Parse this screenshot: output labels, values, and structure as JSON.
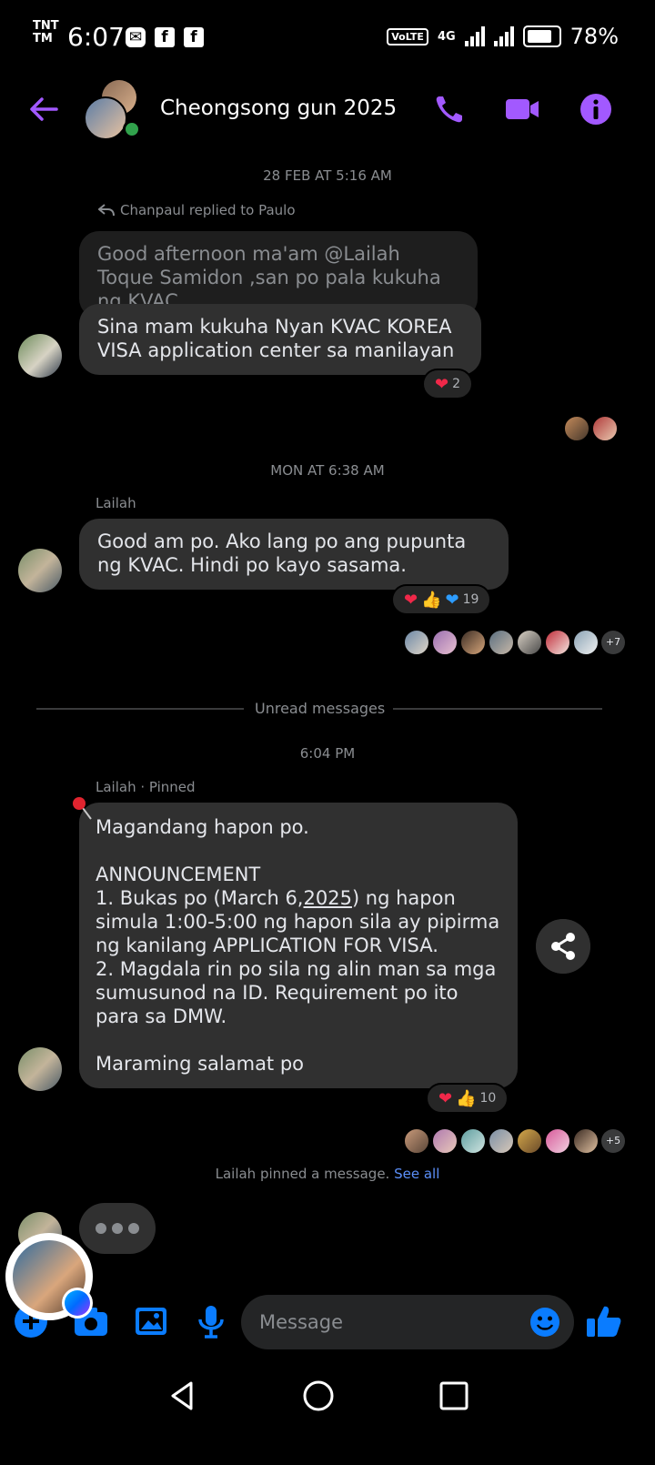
{
  "status_bar": {
    "carrier_line1": "TNT",
    "carrier_line2": "TM",
    "time": "6:07",
    "network": "4G",
    "volte": "VoLTE",
    "battery": "78%",
    "notification_icons": [
      "messenger-notification-icon",
      "facebook-icon",
      "facebook-icon"
    ]
  },
  "header": {
    "title": "Cheongsong gun 2025",
    "accent": "#a259ff",
    "online": true
  },
  "messages": {
    "ts1": "28 FEB AT 5:16 AM",
    "reply_note": "Chanpaul replied to Paulo",
    "quoted_text": "Good afternoon ma'am @Lailah Toque Samidon ,san po pala kukuha ng KVAC",
    "reply_text": "Sina mam  kukuha Nyan  KVAC  KOREA VISA application center sa manilayan",
    "reply_reaction_count": "2",
    "ts2": "MON AT 6:38 AM",
    "sender2": "Lailah",
    "msg2_text": "Good am po. Ako lang po ang pupunta ng KVAC. Hindi po kayo sasama.",
    "msg2_reaction_count": "19",
    "msg2_seen_more": "+7",
    "unread_label": "Unread messages",
    "ts3": "6:04 PM",
    "sender3": "Lailah · Pinned",
    "pinned_lines": [
      "Magandang hapon po.",
      "",
      "ANNOUNCEMENT",
      "1. Bukas po (March 6,2025) ng hapon simula 1:00-5:00 ng hapon sila ay pipirma ng kanilang APPLICATION FOR VISA.",
      "2. Magdala rin po sila ng alin man sa mga sumusunod na ID. Requirement po ito para sa DMW.",
      "",
      "Maraming salamat po"
    ],
    "pinned_l1": "Magandang hapon po.",
    "pinned_l2": "ANNOUNCEMENT",
    "pinned_l3a": "1. Bukas po (March 6,",
    "pinned_l3b": "2025",
    "pinned_l3c": ") ng hapon simula 1:00-5:00 ng hapon sila ay pipirma ng kanilang APPLICATION FOR VISA.",
    "pinned_l4": "2. Magdala rin po sila ng alin man sa mga sumusunod na ID. Requirement po ito para sa DMW.",
    "pinned_l5": "Maraming salamat po",
    "pinned_reaction_count": "10",
    "pinned_seen_more": "+5",
    "pinned_note": "Lailah pinned a message.",
    "see_all": "See all"
  },
  "composer": {
    "placeholder": "Message"
  }
}
